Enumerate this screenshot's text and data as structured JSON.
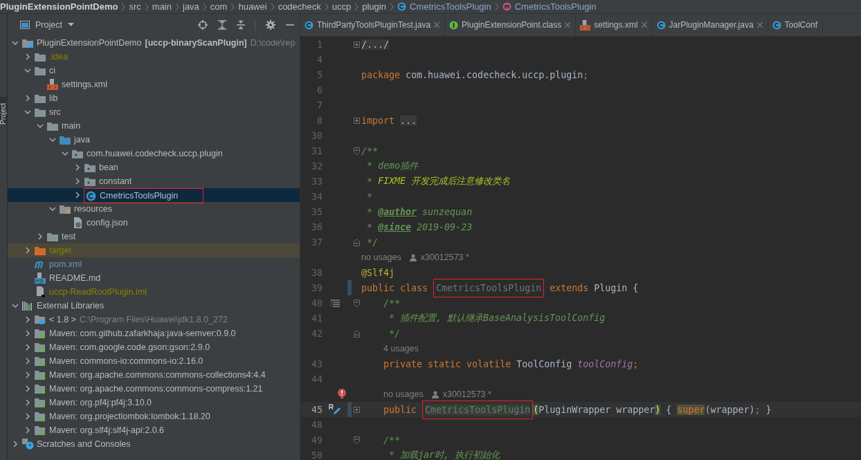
{
  "breadcrumbs": [
    {
      "label": "PluginExtensionPointDemo",
      "kind": "project"
    },
    {
      "label": "src",
      "kind": "folder"
    },
    {
      "label": "main",
      "kind": "folder"
    },
    {
      "label": "java",
      "kind": "folder"
    },
    {
      "label": "com",
      "kind": "folder"
    },
    {
      "label": "huawei",
      "kind": "folder"
    },
    {
      "label": "codecheck",
      "kind": "folder"
    },
    {
      "label": "uccp",
      "kind": "folder"
    },
    {
      "label": "plugin",
      "kind": "folder"
    },
    {
      "label": "CmetricsToolsPlugin",
      "kind": "class"
    },
    {
      "label": "CmetricsToolsPlugin",
      "kind": "method"
    }
  ],
  "side_strip": {
    "label": "Project"
  },
  "project": {
    "title": "Project",
    "tree": [
      {
        "label": "PluginExtensionPointDemo",
        "module": "[uccp-binaryScanPlugin]",
        "path": "D:\\code\\rep",
        "kind": "module",
        "expanded": true,
        "selected": false,
        "children": [
          {
            "label": ".idea",
            "kind": "folder",
            "expanded": false,
            "selected": false,
            "ignored": true
          },
          {
            "label": "ci",
            "kind": "folder",
            "expanded": true,
            "selected": false,
            "children": [
              {
                "label": "settings.xml",
                "kind": "xml",
                "selected": false
              }
            ]
          },
          {
            "label": "lib",
            "kind": "folder",
            "expanded": false,
            "selected": false
          },
          {
            "label": "src",
            "kind": "folder",
            "expanded": true,
            "selected": false,
            "children": [
              {
                "label": "main",
                "kind": "folder",
                "expanded": true,
                "selected": false,
                "children": [
                  {
                    "label": "java",
                    "kind": "source_root",
                    "expanded": true,
                    "selected": false,
                    "children": [
                      {
                        "label": "com.huawei.codecheck.uccp.plugin",
                        "kind": "package",
                        "expanded": true,
                        "selected": false,
                        "children": [
                          {
                            "label": "bean",
                            "kind": "package",
                            "expanded": false,
                            "selected": false
                          },
                          {
                            "label": "constant",
                            "kind": "package",
                            "expanded": false,
                            "selected": false
                          },
                          {
                            "label": "CmetricsToolsPlugin",
                            "kind": "class",
                            "expanded": false,
                            "selected": true,
                            "marked": true
                          }
                        ]
                      }
                    ]
                  },
                  {
                    "label": "resources",
                    "kind": "resources_root",
                    "expanded": true,
                    "selected": false,
                    "children": [
                      {
                        "label": "config.json",
                        "kind": "json",
                        "selected": false
                      }
                    ]
                  }
                ]
              },
              {
                "label": "test",
                "kind": "folder",
                "expanded": false,
                "selected": false
              }
            ]
          },
          {
            "label": "target",
            "kind": "excluded_folder",
            "expanded": false,
            "selected": false,
            "ignored": true,
            "highlighted": true
          },
          {
            "label": "pom.xml",
            "kind": "maven",
            "selected": false,
            "modified": true
          },
          {
            "label": "README.md",
            "kind": "md",
            "selected": false
          },
          {
            "label": "uccp-ReadRootPlugin.iml",
            "kind": "iml",
            "selected": false,
            "ignored": true
          }
        ]
      },
      {
        "label": "External Libraries",
        "kind": "libraries",
        "expanded": true,
        "selected": false,
        "children": [
          {
            "label": "< 1.8 >",
            "path": "C:\\Program Files\\Huawei\\jdk1.8.0_272",
            "kind": "jdk",
            "expanded": false,
            "selected": false
          },
          {
            "label": "Maven: com.github.zafarkhaja:java-semver:0.9.0",
            "kind": "library",
            "expanded": false,
            "selected": false
          },
          {
            "label": "Maven: com.google.code.gson:gson:2.9.0",
            "kind": "library",
            "expanded": false,
            "selected": false
          },
          {
            "label": "Maven: commons-io:commons-io:2.16.0",
            "kind": "library",
            "expanded": false,
            "selected": false
          },
          {
            "label": "Maven: org.apache.commons:commons-collections4:4.4",
            "kind": "library",
            "expanded": false,
            "selected": false
          },
          {
            "label": "Maven: org.apache.commons:commons-compress:1.21",
            "kind": "library",
            "expanded": false,
            "selected": false
          },
          {
            "label": "Maven: org.pf4j:pf4j:3.10.0",
            "kind": "library",
            "expanded": false,
            "selected": false
          },
          {
            "label": "Maven: org.projectlombok:lombok:1.18.20",
            "kind": "library",
            "expanded": false,
            "selected": false
          },
          {
            "label": "Maven: org.slf4j:slf4j-api:2.0.6",
            "kind": "library",
            "expanded": false,
            "selected": false
          }
        ]
      },
      {
        "label": "Scratches and Consoles",
        "kind": "scratches",
        "expanded": false,
        "selected": false
      }
    ]
  },
  "tabs": [
    {
      "label": "ThirdPartyToolsPluginTest.java",
      "kind": "class",
      "selected": false
    },
    {
      "label": "PluginExtensionPoint.class",
      "kind": "interface",
      "selected": false
    },
    {
      "label": "settings.xml",
      "kind": "xml",
      "selected": false
    },
    {
      "label": "JarPluginManager.java",
      "kind": "class",
      "selected": false
    },
    {
      "label": "ToolConf",
      "kind": "class",
      "selected": false
    }
  ],
  "code": [
    {
      "kind": "line",
      "number": "1",
      "fold": {
        "kind": "expand"
      },
      "tokens": [
        {
          "text": "/.../",
          "kind": "folded"
        }
      ]
    },
    {
      "kind": "line",
      "number": "4"
    },
    {
      "kind": "line",
      "number": "5",
      "tokens": [
        {
          "text": "package",
          "kind": "keyword"
        },
        {
          "text": " com.huawei.codecheck.uccp.plugin",
          "kind": "plain"
        },
        {
          "text": ";",
          "kind": "keyword"
        }
      ]
    },
    {
      "kind": "line",
      "number": "6"
    },
    {
      "kind": "line",
      "number": "7"
    },
    {
      "kind": "line",
      "number": "8",
      "fold": {
        "kind": "expand"
      },
      "tokens": [
        {
          "text": "import ",
          "kind": "keyword"
        },
        {
          "text": "...",
          "kind": "folded"
        }
      ]
    },
    {
      "kind": "line",
      "number": "30"
    },
    {
      "kind": "line",
      "number": "31",
      "fold": {
        "kind": "collapse"
      },
      "tokens": [
        {
          "text": "/**",
          "kind": "comment"
        }
      ]
    },
    {
      "kind": "line",
      "number": "32",
      "tokens": [
        {
          "text": " * demo插件",
          "kind": "comment"
        }
      ]
    },
    {
      "kind": "line",
      "number": "33",
      "tokens": [
        {
          "text": " * ",
          "kind": "comment"
        },
        {
          "text": "FIXME 开发完成后注意修改类名",
          "kind": "todo"
        }
      ]
    },
    {
      "kind": "line",
      "number": "34",
      "tokens": [
        {
          "text": " *",
          "kind": "comment"
        }
      ]
    },
    {
      "kind": "line",
      "number": "35",
      "tokens": [
        {
          "text": " * ",
          "kind": "comment"
        },
        {
          "text": "@author",
          "kind": "doc_tag"
        },
        {
          "text": " sunzequan",
          "kind": "comment"
        }
      ]
    },
    {
      "kind": "line",
      "number": "36",
      "tokens": [
        {
          "text": " * ",
          "kind": "comment"
        },
        {
          "text": "@since",
          "kind": "doc_tag"
        },
        {
          "text": " 2019-09-23",
          "kind": "comment"
        }
      ]
    },
    {
      "kind": "line",
      "number": "37",
      "fold": {
        "kind": "end"
      },
      "tokens": [
        {
          "text": " */",
          "kind": "comment"
        }
      ]
    },
    {
      "kind": "hint",
      "indented": false,
      "warning": false,
      "usages": "no usages",
      "author": "x30012573 *"
    },
    {
      "kind": "line",
      "number": "38",
      "tokens": [
        {
          "text": "@Slf4j",
          "kind": "annotation"
        }
      ]
    },
    {
      "kind": "line",
      "number": "39",
      "changed": true,
      "tokens": [
        {
          "text": "public class ",
          "kind": "keyword"
        },
        {
          "text": "CmetricsToolsPlugin",
          "kind": "unused",
          "marked": true
        },
        {
          "text": " extends ",
          "kind": "keyword"
        },
        {
          "text": "Plugin {",
          "kind": "plain"
        }
      ]
    },
    {
      "kind": "line",
      "number": "40",
      "fold": {
        "kind": "collapse"
      },
      "gutter": {
        "kind": "list"
      },
      "tokens": [
        {
          "text": "    /**",
          "kind": "comment"
        }
      ]
    },
    {
      "kind": "line",
      "number": "41",
      "tokens": [
        {
          "text": "     * 插件配置, 默认继承BaseAnalysisToolConfig",
          "kind": "comment"
        }
      ]
    },
    {
      "kind": "line",
      "number": "42",
      "fold": {
        "kind": "end"
      },
      "tokens": [
        {
          "text": "     */",
          "kind": "comment"
        }
      ]
    },
    {
      "kind": "hint",
      "indented": true,
      "warning": false,
      "usages": "4 usages"
    },
    {
      "kind": "line",
      "number": "43",
      "tokens": [
        {
          "text": "    private static volatile ",
          "kind": "keyword"
        },
        {
          "text": "ToolConfig ",
          "kind": "plain"
        },
        {
          "text": "toolConfig",
          "kind": "field"
        },
        {
          "text": ";",
          "kind": "keyword"
        }
      ]
    },
    {
      "kind": "line",
      "number": "44"
    },
    {
      "kind": "hint",
      "indented": true,
      "warning": true,
      "usages": "no usages",
      "author": "x30012573 *"
    },
    {
      "kind": "line",
      "number": "45",
      "fold": {
        "kind": "expand"
      },
      "current": true,
      "changed": true,
      "gutter": {
        "kind": "edit"
      },
      "tokens": [
        {
          "text": "    public ",
          "kind": "keyword"
        },
        {
          "text": "CmetricsToolsPlugin",
          "kind": "unused_usage",
          "marked": true
        },
        {
          "text": "(",
          "kind": "brace_match"
        },
        {
          "text": "PluginWrapper wrapper",
          "kind": "plain"
        },
        {
          "text": ")",
          "kind": "brace_match"
        },
        {
          "text": " { ",
          "kind": "plain"
        },
        {
          "text": "super",
          "kind": "keyword_hl"
        },
        {
          "text": "(wrapper)",
          "kind": "plain"
        },
        {
          "text": "; ",
          "kind": "keyword"
        },
        {
          "text": "}",
          "kind": "plain"
        }
      ]
    },
    {
      "kind": "line",
      "number": "48"
    },
    {
      "kind": "line",
      "number": "49",
      "fold": {
        "kind": "collapse"
      },
      "tokens": [
        {
          "text": "    /**",
          "kind": "comment"
        }
      ]
    },
    {
      "kind": "line",
      "number": "50",
      "tokens": [
        {
          "text": "     * 加载jar时, 执行初始化",
          "kind": "comment"
        }
      ]
    }
  ]
}
